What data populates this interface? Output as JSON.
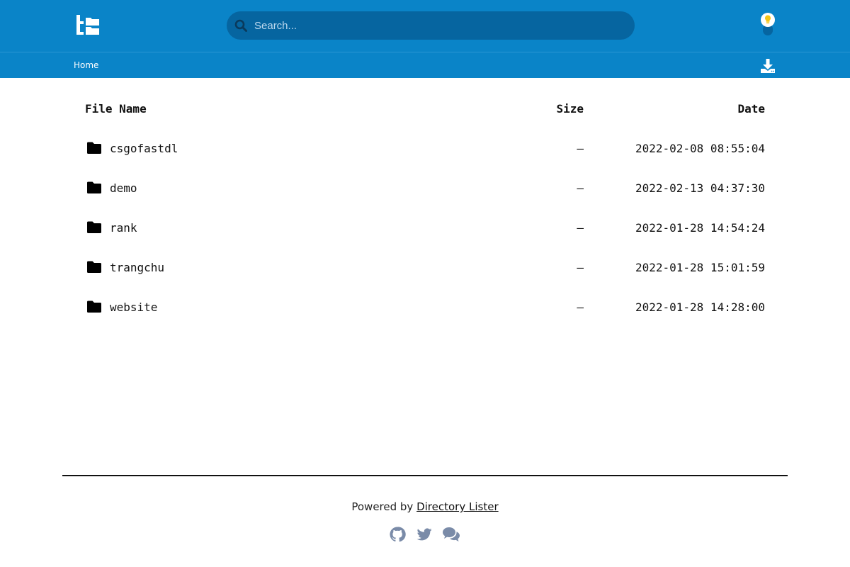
{
  "header": {
    "search": {
      "placeholder": "Search...",
      "value": ""
    }
  },
  "breadcrumb": {
    "home_label": "Home"
  },
  "table": {
    "columns": {
      "name": "File Name",
      "size": "Size",
      "date": "Date"
    },
    "rows": [
      {
        "name": "csgofastdl",
        "size": "—",
        "date": "2022-02-08 08:55:04"
      },
      {
        "name": "demo",
        "size": "—",
        "date": "2022-02-13 04:37:30"
      },
      {
        "name": "rank",
        "size": "—",
        "date": "2022-01-28 14:54:24"
      },
      {
        "name": "trangchu",
        "size": "—",
        "date": "2022-01-28 15:01:59"
      },
      {
        "name": "website",
        "size": "—",
        "date": "2022-01-28 14:28:00"
      }
    ]
  },
  "footer": {
    "powered_by": "Powered by",
    "link_label": "Directory Lister",
    "icons": [
      "github-icon",
      "twitter-icon",
      "chat-icon"
    ]
  },
  "colors": {
    "header_bg": "#0a84c8",
    "search_bg": "#0665a0",
    "bulb": "#f5c518",
    "social_icons": "#7a8ba8"
  }
}
